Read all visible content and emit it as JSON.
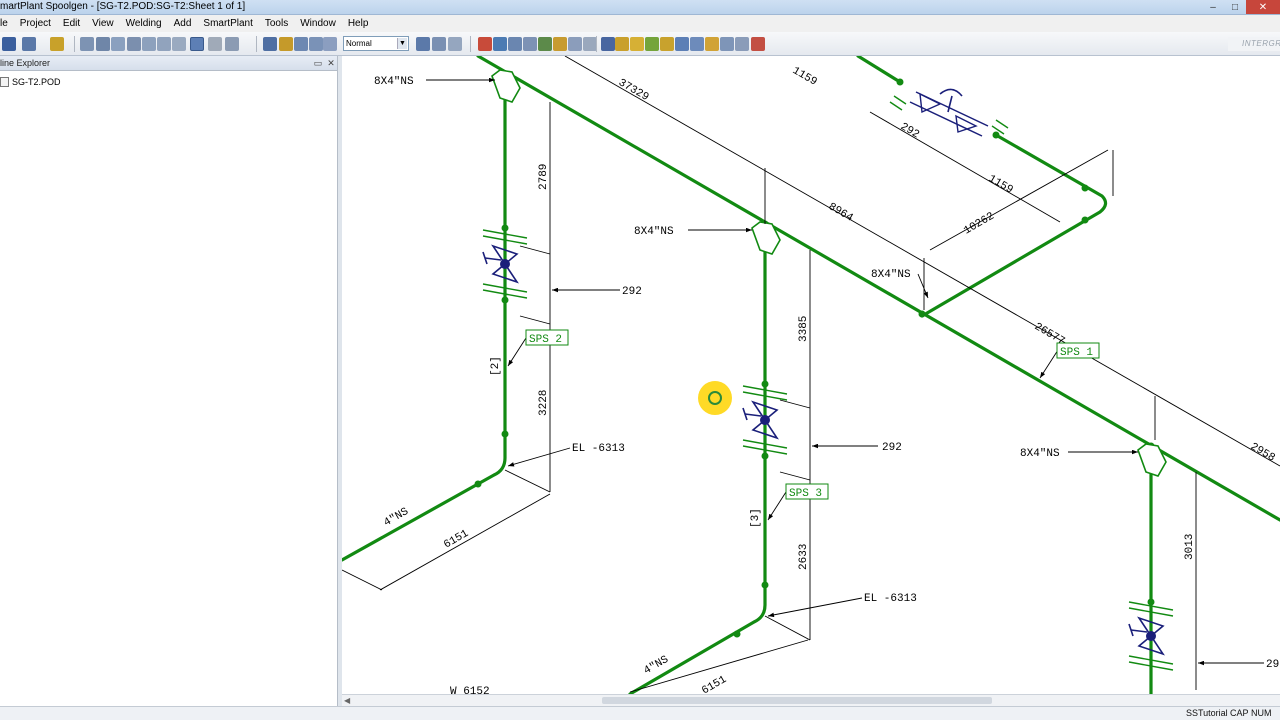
{
  "window": {
    "title": "martPlant Spoolgen - [SG-T2.POD:SG-T2:Sheet 1 of 1]"
  },
  "menu": [
    "le",
    "Project",
    "Edit",
    "View",
    "Welding",
    "Add",
    "SmartPlant",
    "Tools",
    "Window",
    "Help"
  ],
  "toolbar": {
    "style_select_value": "Normal",
    "brand_text": "INTERGRAPH"
  },
  "explorer": {
    "title": "line Explorer",
    "items": [
      {
        "label": "SG-T2.POD"
      }
    ]
  },
  "drawing": {
    "labels": {
      "ns_a": "8X4\"NS",
      "ns_b": "8X4\"NS",
      "ns_c": "8X4\"NS",
      "ns_d": "8X4\"NS",
      "ns_e": "4\"NS",
      "ns_f": "4\"NS",
      "dim_37329": "37329",
      "dim_1159a": "1159",
      "dim_292a": "292",
      "dim_1159b": "1159",
      "dim_10262": "10262",
      "dim_8964": "8964",
      "dim_26577": "26577",
      "dim_2958": "2958",
      "dim_2789": "2789",
      "dim_292b": "292",
      "dim_3228": "3228",
      "dim_3385": "3385",
      "dim_292c": "292",
      "dim_2633": "2633",
      "dim_3013": "3013",
      "dim_6151a": "6151",
      "dim_6151b": "6151",
      "dim_29": "29",
      "el_a": "EL -6313",
      "el_b": "EL -6313",
      "w_coord": "W 6152",
      "spool_1": "SPS 1",
      "spool_2": "SPS 2",
      "spool_3": "SPS 3",
      "mark_2": "[2]",
      "mark_3": "[3]"
    }
  },
  "status": {
    "user": "SSTutorial",
    "cap": "CAP",
    "num": "NUM"
  },
  "colors": {
    "pipe": "#128a12",
    "valve": "#1a1f7a",
    "dimension": "#000000",
    "cursor_highlight": "#ffd400"
  }
}
